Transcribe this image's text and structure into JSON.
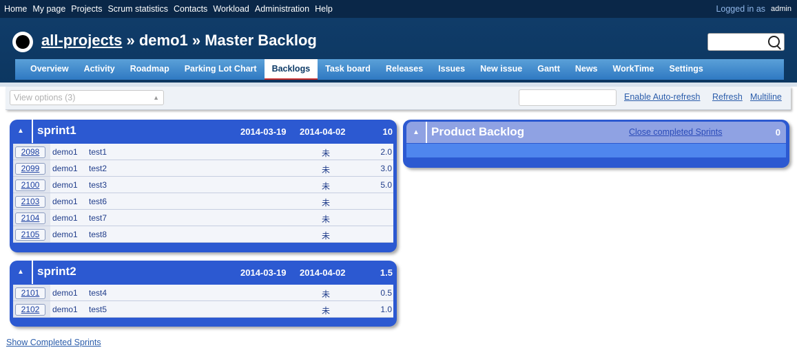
{
  "top_menu": {
    "items": [
      "Home",
      "My page",
      "Projects",
      "Scrum statistics",
      "Contacts",
      "Workload",
      "Administration",
      "Help"
    ],
    "logged_in_label": "Logged in as",
    "user": "admin"
  },
  "header": {
    "title_link": "all-projects",
    "title_rest": " » demo1 » Master Backlog",
    "search_value": ""
  },
  "main_menu": {
    "tabs": [
      "Overview",
      "Activity",
      "Roadmap",
      "Parking Lot Chart",
      "Backlogs",
      "Task board",
      "Releases",
      "Issues",
      "New issue",
      "Gantt",
      "News",
      "WorkTime",
      "Settings"
    ],
    "selected": "Backlogs"
  },
  "toolbar": {
    "view_options": "View options (3)",
    "enable_auto_refresh": "Enable Auto-refresh",
    "refresh": "Refresh",
    "multiline": "Multiline"
  },
  "sprints": [
    {
      "name": "sprint1",
      "start": "2014-03-19",
      "end": "2014-04-02",
      "points": "10",
      "stories": [
        {
          "id": "2098",
          "project": "demo1",
          "subject": "test1",
          "status": "未",
          "points": "2.0"
        },
        {
          "id": "2099",
          "project": "demo1",
          "subject": "test2",
          "status": "未",
          "points": "3.0"
        },
        {
          "id": "2100",
          "project": "demo1",
          "subject": "test3",
          "status": "未",
          "points": "5.0"
        },
        {
          "id": "2103",
          "project": "demo1",
          "subject": "test6",
          "status": "未",
          "points": ""
        },
        {
          "id": "2104",
          "project": "demo1",
          "subject": "test7",
          "status": "未",
          "points": ""
        },
        {
          "id": "2105",
          "project": "demo1",
          "subject": "test8",
          "status": "未",
          "points": ""
        }
      ]
    },
    {
      "name": "sprint2",
      "start": "2014-03-19",
      "end": "2014-04-02",
      "points": "1.5",
      "stories": [
        {
          "id": "2101",
          "project": "demo1",
          "subject": "test4",
          "status": "未",
          "points": "0.5"
        },
        {
          "id": "2102",
          "project": "demo1",
          "subject": "test5",
          "status": "未",
          "points": "1.0"
        }
      ]
    }
  ],
  "product_backlog": {
    "title": "Product Backlog",
    "close_link": "Close completed Sprints",
    "points": "0"
  },
  "show_completed": "Show Completed Sprints",
  "colors": {
    "top_bar": "#0a2748",
    "header": "#0f3a66",
    "sprint_panel": "#2c59d1",
    "product_backlog_header": "#8fa2e3",
    "selected_tab_underline": "#c62b2b"
  }
}
